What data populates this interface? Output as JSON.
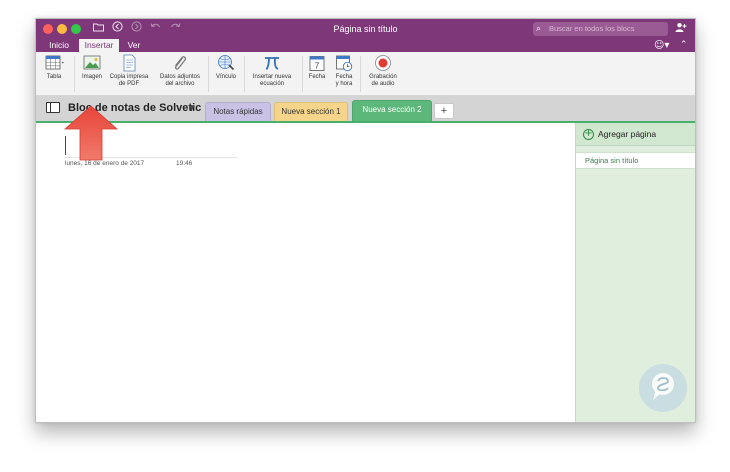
{
  "window": {
    "title": "Página sin título",
    "search_placeholder": "Buscar en todos los blocs"
  },
  "ribbon_tabs": [
    {
      "label": "Inicio",
      "active": false
    },
    {
      "label": "Insertar",
      "active": true
    },
    {
      "label": "Ver",
      "active": false
    }
  ],
  "ribbon_buttons": {
    "tabla": "Tabla",
    "imagen": "Imagen",
    "copia_pdf": [
      "Copia impresa",
      "de PDF"
    ],
    "adjuntos": [
      "Datos adjuntos",
      "del archivo"
    ],
    "vinculo": "Vínculo",
    "ecuacion": [
      "Insertar nueva",
      "ecuación"
    ],
    "fecha": "Fecha",
    "fecha_hora": [
      "Fecha",
      "y hora"
    ],
    "grabacion": [
      "Grabación",
      "de audio"
    ]
  },
  "notebook": {
    "title": "Bloc de notas de Solvetic"
  },
  "sections": [
    {
      "label": "Notas rápidas",
      "color": "#c9c2e6",
      "active": false
    },
    {
      "label": "Nueva sección 1",
      "color": "#f6d58a",
      "active": false
    },
    {
      "label": "Nueva sección 2",
      "color": "#5cb87a",
      "active": true
    }
  ],
  "add_section_label": "+",
  "page": {
    "date": "lunes, 16 de enero de 2017",
    "time": "19:46"
  },
  "pages_panel": {
    "add_page_label": "Agregar página",
    "pages": [
      "Página sin título"
    ]
  },
  "colors": {
    "accent": "#7e3778",
    "section_green": "#49b06b",
    "annotation_arrow": "#e8443a"
  }
}
